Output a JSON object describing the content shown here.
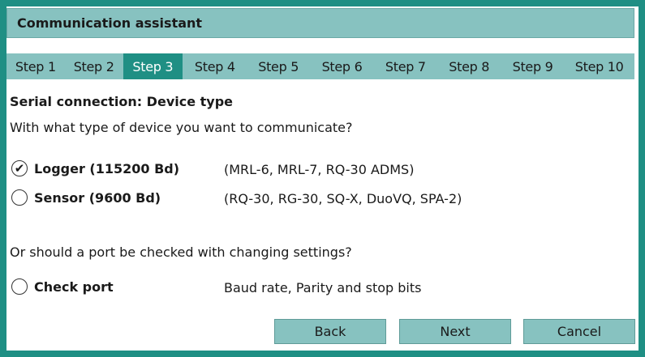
{
  "title": "Communication assistant",
  "steps": [
    {
      "label": "Step 1"
    },
    {
      "label": "Step 2"
    },
    {
      "label": "Step 3"
    },
    {
      "label": "Step 4"
    },
    {
      "label": "Step 5"
    },
    {
      "label": "Step 6"
    },
    {
      "label": "Step 7"
    },
    {
      "label": "Step 8"
    },
    {
      "label": "Step 9"
    },
    {
      "label": "Step 10"
    }
  ],
  "active_step": "Step 3",
  "section_title": "Serial connection: Device type",
  "question": "With what type of device you want to communicate?",
  "options": [
    {
      "label": "Logger (115200 Bd)",
      "desc": "(MRL-6, MRL-7, RQ-30 ADMS)",
      "checked": true
    },
    {
      "label": "Sensor (9600 Bd)",
      "desc": "(RQ-30, RG-30, SQ-X, DuoVQ, SPA-2)",
      "checked": false
    }
  ],
  "question2": "Or should a port be checked with changing settings?",
  "check_port": {
    "label": "Check port",
    "desc": "Baud rate, Parity and stop bits",
    "checked": false
  },
  "buttons": {
    "back": "Back",
    "next": "Next",
    "cancel": "Cancel"
  },
  "colors": {
    "frame": "#1f8f84",
    "bar": "#87c2c0",
    "active_step": "#1f8f84"
  }
}
